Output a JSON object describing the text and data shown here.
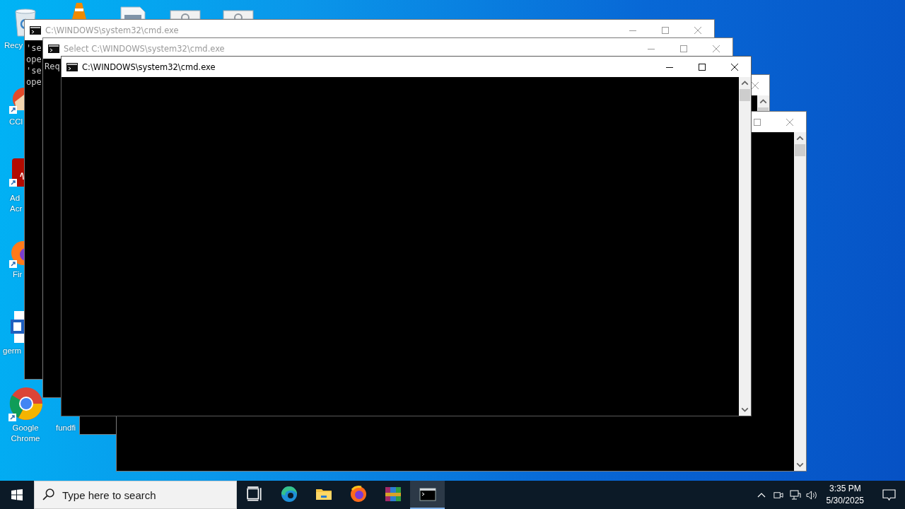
{
  "desktop_icons": [
    {
      "kind": "recycle-bin",
      "label": "Recy"
    },
    {
      "kind": "ccleaner",
      "label": "CCl"
    },
    {
      "kind": "acrobat",
      "label": "Ad Acr"
    },
    {
      "kind": "firefox",
      "label": "Fir"
    },
    {
      "kind": "word",
      "label": "germ"
    },
    {
      "kind": "chrome",
      "label": "Google Chrome"
    },
    {
      "label": "fundfi"
    },
    {
      "kind": "vlc"
    },
    {
      "kind": "document"
    },
    {
      "kind": "settings-file"
    },
    {
      "kind": "settings-file"
    }
  ],
  "windows": [
    {
      "active": false
    },
    {
      "active": false
    },
    {
      "title": "C:\\WINDOWS\\system32\\cmd.exe",
      "active": false,
      "lines": [
        "'se",
        "ope",
        "'se",
        "ope"
      ]
    },
    {
      "title": "Select C:\\WINDOWS\\system32\\cmd.exe",
      "active": false,
      "lines": [
        "Req"
      ]
    },
    {
      "title": "C:\\WINDOWS\\system32\\cmd.exe",
      "active": true
    }
  ],
  "taskbar": {
    "search": {
      "placeholder": "Type here to search"
    },
    "apps": [
      {
        "kind": "task-view",
        "selected": false
      },
      {
        "kind": "edge",
        "selected": false
      },
      {
        "kind": "explorer",
        "selected": false
      },
      {
        "kind": "firefox",
        "selected": false
      },
      {
        "kind": "winrar",
        "selected": false
      },
      {
        "kind": "cmd",
        "selected": true
      }
    ],
    "time": "3:35 PM",
    "date": "5/30/2025"
  }
}
